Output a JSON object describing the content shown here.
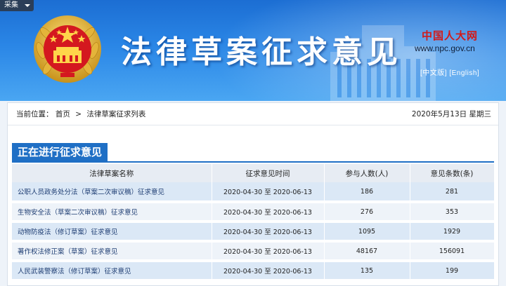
{
  "banner": {
    "collect_label": "采集",
    "title": "法律草案征求意见",
    "npc_logo_text": "中国人大网",
    "npc_url": "www.npc.gov.cn",
    "lang_cn": "[中文版]",
    "lang_en": "[English]"
  },
  "breadcrumb": {
    "prefix": "当前位置：",
    "home": "首页",
    "separator": ">",
    "current": "法律草案征求列表"
  },
  "date_text": "2020年5月13日  星期三",
  "section_title": "正在进行征求意见",
  "table": {
    "headers": [
      "法律草案名称",
      "征求意见时间",
      "参与人数(人)",
      "意见条数(条)"
    ],
    "rows": [
      {
        "name": "公职人员政务处分法（草案二次审议稿）征求意见",
        "period": "2020-04-30 至 2020-06-13",
        "participants": "186",
        "opinions": "281"
      },
      {
        "name": "生物安全法（草案二次审议稿）征求意见",
        "period": "2020-04-30 至 2020-06-13",
        "participants": "276",
        "opinions": "353"
      },
      {
        "name": "动物防疫法（修订草案）征求意见",
        "period": "2020-04-30 至 2020-06-13",
        "participants": "1095",
        "opinions": "1929"
      },
      {
        "name": "著作权法修正案（草案）征求意见",
        "period": "2020-04-30 至 2020-06-13",
        "participants": "48167",
        "opinions": "156091"
      },
      {
        "name": "人民武装警察法（修订草案）征求意见",
        "period": "2020-04-30 至 2020-06-13",
        "participants": "135",
        "opinions": "199"
      }
    ]
  },
  "colors": {
    "banner_top": "#1c6ed3",
    "banner_bottom": "#4aa6f2",
    "section_blue": "#1f6fc5",
    "row_odd": "#dbe8f6",
    "row_even": "#eef3f9",
    "npc_red": "#d11a1a"
  }
}
